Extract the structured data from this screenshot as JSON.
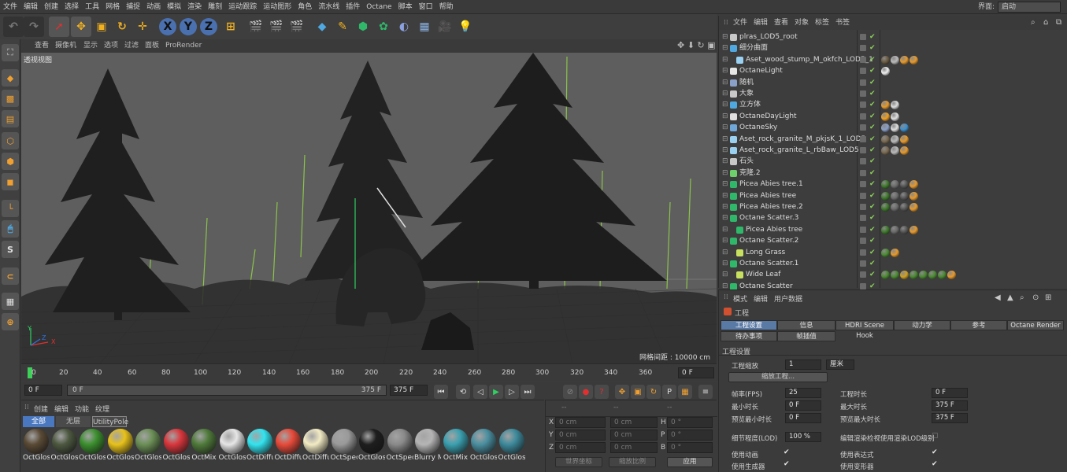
{
  "menubar": {
    "items": [
      "文件",
      "编辑",
      "创建",
      "选择",
      "工具",
      "网格",
      "捕捉",
      "动画",
      "模拟",
      "渲染",
      "雕刻",
      "运动跟踪",
      "运动图形",
      "角色",
      "流水线",
      "插件",
      "Octane",
      "脚本",
      "窗口",
      "帮助"
    ],
    "layout_label": "界面:",
    "layout_value": "启动"
  },
  "viewport": {
    "menu": [
      "查看",
      "摄像机",
      "显示",
      "选项",
      "过滤",
      "面板",
      "ProRender"
    ],
    "label": "透视视图",
    "grid_spacing": "网格间距 : 10000 cm",
    "axis_x": "X",
    "axis_y": "Y",
    "axis_z": "Z"
  },
  "timeline": {
    "ticks": [
      "0",
      "20",
      "40",
      "60",
      "80",
      "100",
      "120",
      "140",
      "160",
      "180",
      "200",
      "220",
      "240",
      "260",
      "280",
      "300",
      "320",
      "340",
      "360"
    ],
    "current_frame": "0 F",
    "start_field": "0 F",
    "range_start": "0 F",
    "range_end": "375 F",
    "end_field": "375 F"
  },
  "material_manager": {
    "menu": [
      "创建",
      "编辑",
      "功能",
      "纹理"
    ],
    "tabs": [
      "全部",
      "无层",
      "UtilityPole"
    ],
    "materials": [
      {
        "name": "OctGlos",
        "color": "#5a4a35"
      },
      {
        "name": "OctGlos",
        "color": "#4d5840"
      },
      {
        "name": "OctGlos",
        "color": "#3b8f2e"
      },
      {
        "name": "OctGlos",
        "color": "#e8c21a"
      },
      {
        "name": "OctGlos",
        "color": "#6b8f56"
      },
      {
        "name": "OctGlos",
        "color": "#d9363c"
      },
      {
        "name": "OctMix",
        "color": "#4f7a3a"
      },
      {
        "name": "OctGlos",
        "color": "#e6e6e6"
      },
      {
        "name": "OctDiffu",
        "color": "#32e4f0"
      },
      {
        "name": "OctDiffu",
        "color": "#e84a3a"
      },
      {
        "name": "OctDiffu",
        "color": "#f2ebc4"
      },
      {
        "name": "OctSpec",
        "color": "#9a9a9a"
      },
      {
        "name": "OctGlos",
        "color": "#1e1e1e"
      },
      {
        "name": "OctSpec",
        "color": "#8a8a8a"
      },
      {
        "name": "Blurry M",
        "color": "#b5b5b5"
      },
      {
        "name": "OctMix",
        "color": "#3aa0b0"
      },
      {
        "name": "OctGlos",
        "color": "#4a8fa0"
      },
      {
        "name": "OctGlos",
        "color": "#3d8a9c"
      }
    ]
  },
  "coordinates": {
    "header": [
      "--",
      "--",
      "--"
    ],
    "rows": [
      {
        "axis": "X",
        "pos": "0 cm",
        "size": "0 cm",
        "rot_axis": "H",
        "rot": "0 °"
      },
      {
        "axis": "Y",
        "pos": "0 cm",
        "size": "0 cm",
        "rot_axis": "P",
        "rot": "0 °"
      },
      {
        "axis": "Z",
        "pos": "0 cm",
        "size": "0 cm",
        "rot_axis": "B",
        "rot": "0 °"
      }
    ],
    "coord_mode": "世界坐标",
    "scale_mode": "缩放比例",
    "apply": "应用"
  },
  "object_manager": {
    "menu": [
      "文件",
      "编辑",
      "查看",
      "对象",
      "标签",
      "书签"
    ],
    "objects": [
      {
        "name": "plras_LOD5_root",
        "indent": 0,
        "icon": "#c8c8c8",
        "tags": []
      },
      {
        "name": "细分曲面",
        "indent": 0,
        "icon": "#4fa8e0",
        "tags": []
      },
      {
        "name": "Aset_wood_stump_M_okfch_LOD5_1",
        "indent": 1,
        "icon": "#9ad0f0",
        "tags": [
          "#6b5a40",
          "#bbbbbb",
          "#e89a2a",
          "#e89a2a"
        ]
      },
      {
        "name": "OctaneLight",
        "indent": 0,
        "icon": "#e6e6e6",
        "tags": [
          "#f0f0f0"
        ]
      },
      {
        "name": "随机",
        "indent": 0,
        "icon": "#8aa0c8",
        "tags": []
      },
      {
        "name": "大象",
        "indent": 0,
        "icon": "#c8c8c8",
        "tags": []
      },
      {
        "name": "立方体",
        "indent": 0,
        "icon": "#4fa8e0",
        "tags": [
          "#e89a2a",
          "#dddddd"
        ]
      },
      {
        "name": "OctaneDayLight",
        "indent": 0,
        "icon": "#e0e0e0",
        "tags": [
          "#f0a020",
          "#e0e0e0"
        ]
      },
      {
        "name": "OctaneSky",
        "indent": 0,
        "icon": "#6fa8d8",
        "tags": [
          "#8aa0c8",
          "#e0e0e0",
          "#3a8fd0"
        ]
      },
      {
        "name": "Aset_rock_granite_M_pkjsK_1_LOD5",
        "indent": 0,
        "icon": "#9ad0f0",
        "tags": [
          "#7a6a50",
          "#bbbbbb",
          "#e89a2a"
        ]
      },
      {
        "name": "Aset_rock_granite_L_rbBaw_LOD5",
        "indent": 0,
        "icon": "#9ad0f0",
        "tags": [
          "#7a6a50",
          "#bbbbbb",
          "#e89a2a"
        ]
      },
      {
        "name": "石头",
        "indent": 0,
        "icon": "#c8c8c8",
        "tags": []
      },
      {
        "name": "克隆.2",
        "indent": 0,
        "icon": "#6dd06a",
        "tags": []
      },
      {
        "name": "Picea Abies tree.1",
        "indent": 0,
        "icon": "#2fb86a",
        "tags": [
          "#3d7a2a",
          "#6a6a6a",
          "#555555",
          "#e89a2a"
        ]
      },
      {
        "name": "Picea Abies tree",
        "indent": 0,
        "icon": "#2fb86a",
        "tags": [
          "#3d7a2a",
          "#6a6a6a",
          "#555555",
          "#e89a2a"
        ]
      },
      {
        "name": "Picea Abies tree.2",
        "indent": 0,
        "icon": "#2fb86a",
        "tags": [
          "#3d7a2a",
          "#6a6a6a",
          "#555555",
          "#e89a2a"
        ]
      },
      {
        "name": "Octane Scatter.3",
        "indent": 0,
        "icon": "#2fb86a",
        "tags": []
      },
      {
        "name": "Picea Abies tree",
        "indent": 1,
        "icon": "#2fb86a",
        "tags": [
          "#3d7a2a",
          "#6a6a6a",
          "#555555",
          "#e89a2a"
        ]
      },
      {
        "name": "Octane Scatter.2",
        "indent": 0,
        "icon": "#2fb86a",
        "tags": []
      },
      {
        "name": "Long Grass",
        "indent": 1,
        "icon": "#c8e060",
        "tags": [
          "#4a8a30",
          "#e89a2a"
        ]
      },
      {
        "name": "Octane Scatter.1",
        "indent": 0,
        "icon": "#2fb86a",
        "tags": []
      },
      {
        "name": "Wide Leaf",
        "indent": 1,
        "icon": "#c8e060",
        "tags": [
          "#4a8a30",
          "#4a8a30",
          "#d0a020",
          "#4a8a30",
          "#4a8a30",
          "#4a8a30",
          "#4a8a30",
          "#e89a2a"
        ]
      },
      {
        "name": "Octane Scatter",
        "indent": 0,
        "icon": "#2fb86a",
        "tags": []
      }
    ]
  },
  "attributes": {
    "menu": [
      "模式",
      "编辑",
      "用户数据"
    ],
    "title": "工程",
    "tabs_row1": [
      "工程设置",
      "信息",
      "HDRI Scene Hook",
      "动力学",
      "参考",
      "Octane Render"
    ],
    "tabs_row2": [
      "待办事项",
      "帧插值"
    ],
    "section": "工程设置",
    "scale_label": "工程缩放",
    "scale_value": "1",
    "scale_unit": "厘米",
    "scale_button": "缩放工程...",
    "fps_label": "帧率(FPS)",
    "fps_value": "25",
    "min_time_label": "最小时长",
    "min_time_value": "0 F",
    "preview_min_label": "预览最小时长",
    "preview_min_value": "0 F",
    "lod_label": "细节程度(LOD)",
    "lod_value": "100 %",
    "proj_time_label": "工程时长",
    "proj_time_value": "0 F",
    "max_time_label": "最大时长",
    "max_time_value": "375 F",
    "preview_max_label": "预览最大时长",
    "preview_max_value": "375 F",
    "editor_lod_label": "编辑渲染检视使用渲染LOD级别",
    "use_anim_label": "使用动画",
    "use_expr_label": "使用表达式",
    "use_gen_label": "使用生成器",
    "use_deform_label": "使用变形器"
  }
}
